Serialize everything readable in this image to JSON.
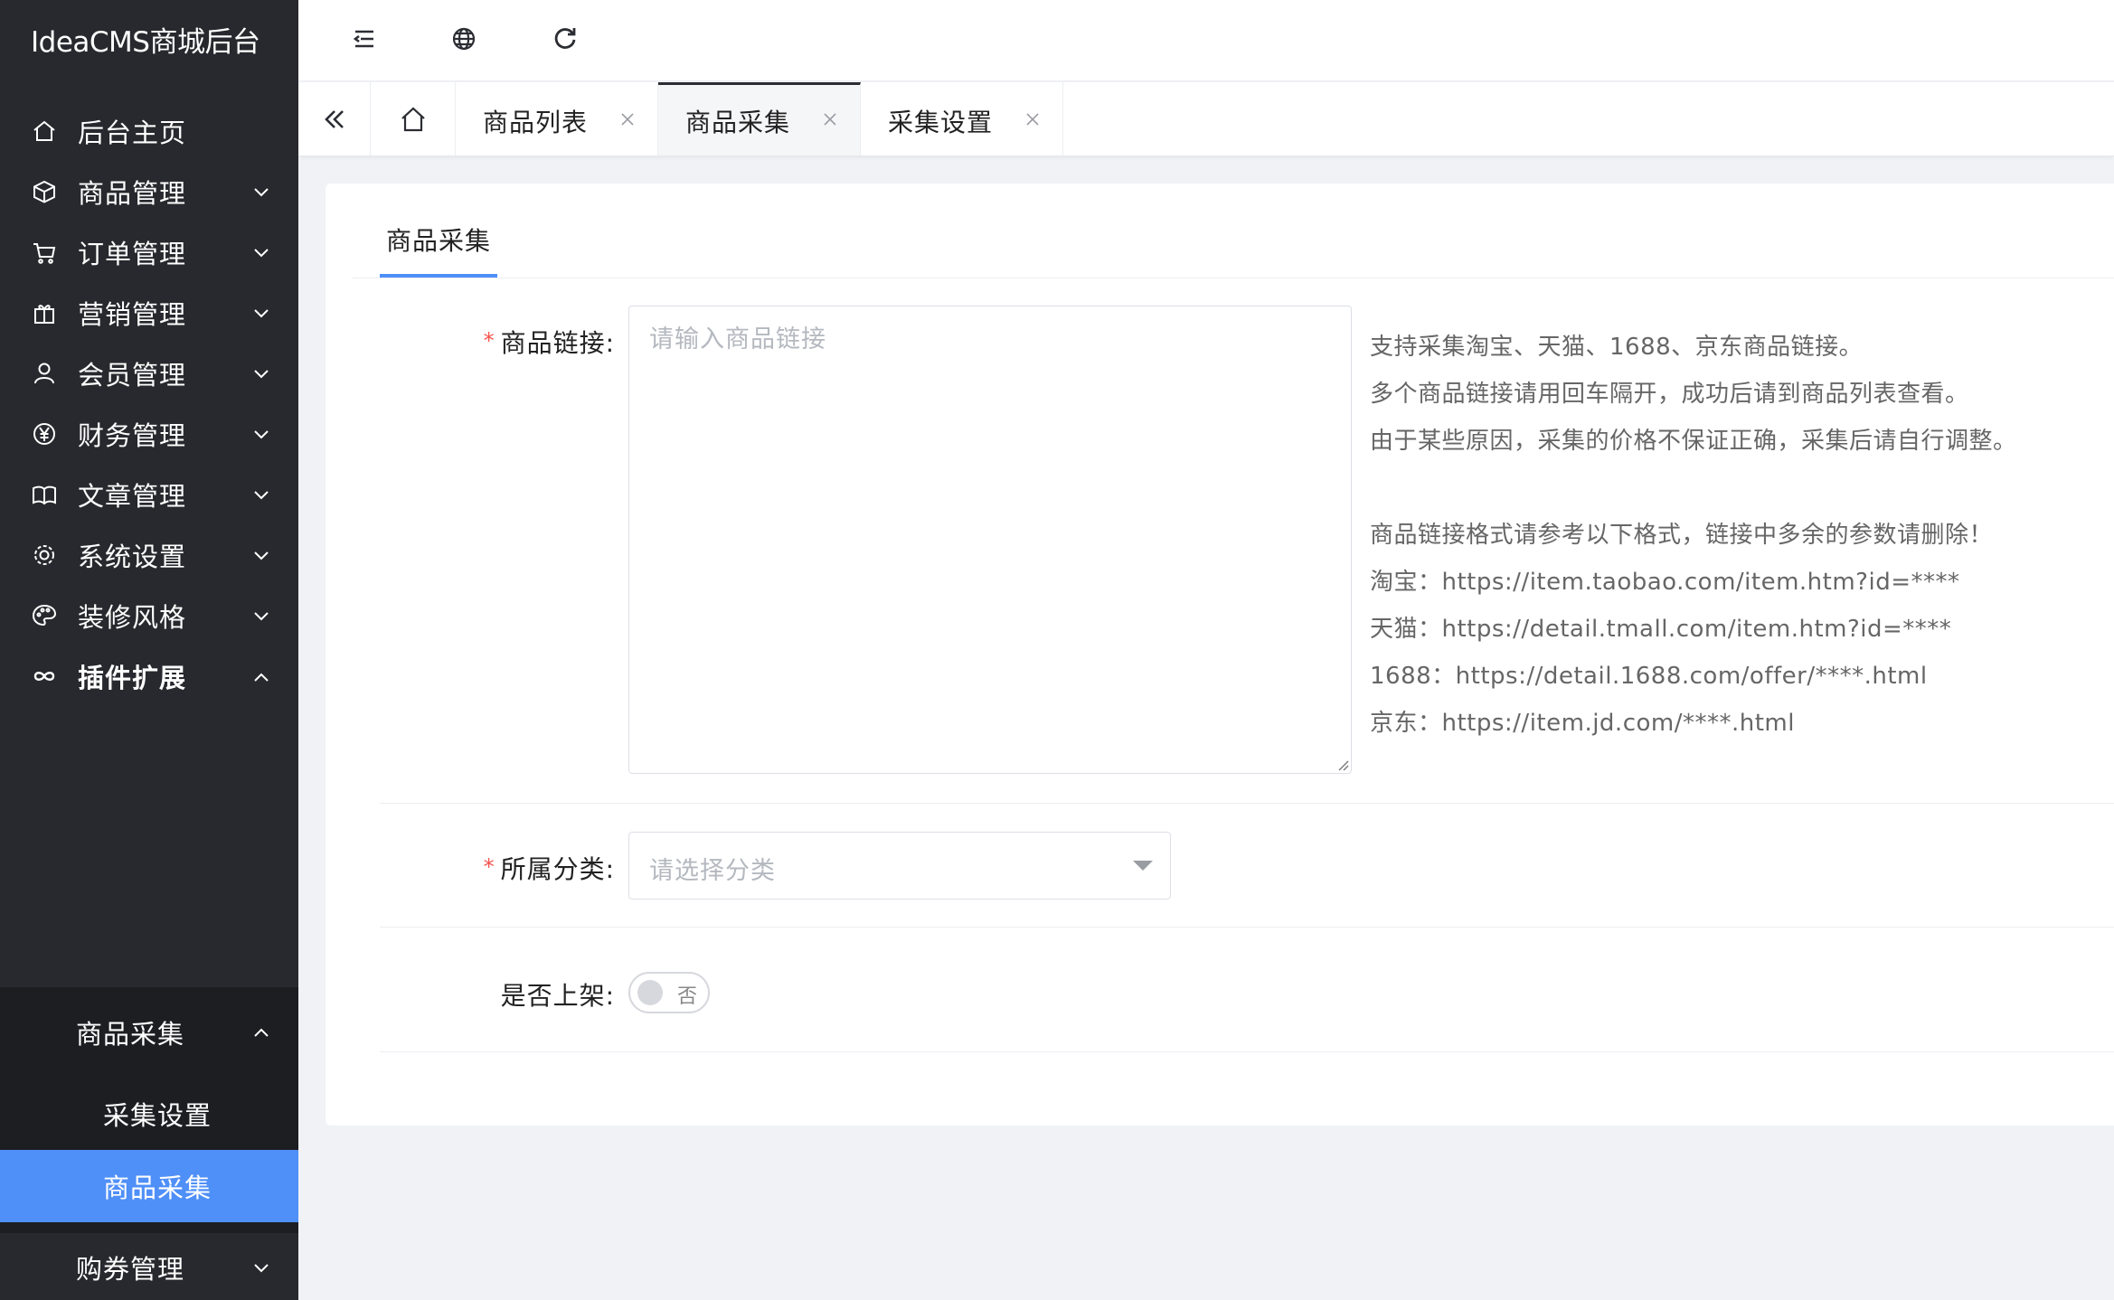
{
  "app": {
    "title": "IdeaCMS商城后台"
  },
  "sidebar": {
    "items": [
      {
        "label": "后台主页",
        "icon": "home-icon"
      },
      {
        "label": "商品管理",
        "icon": "box-icon"
      },
      {
        "label": "订单管理",
        "icon": "cart-icon"
      },
      {
        "label": "营销管理",
        "icon": "gift-icon"
      },
      {
        "label": "会员管理",
        "icon": "user-icon"
      },
      {
        "label": "财务管理",
        "icon": "yen-icon"
      },
      {
        "label": "文章管理",
        "icon": "book-icon"
      },
      {
        "label": "系统设置",
        "icon": "gear-icon"
      },
      {
        "label": "装修风格",
        "icon": "palette-icon"
      },
      {
        "label": "插件扩展",
        "icon": "infinity-icon",
        "expanded": true
      }
    ],
    "submenu": {
      "group_label": "商品采集",
      "children": [
        {
          "label": "采集设置"
        },
        {
          "label": "商品采集",
          "active": true
        }
      ]
    },
    "after_items": [
      {
        "label": "购券管理"
      }
    ]
  },
  "topbar": {
    "icons": [
      "menu-fold-icon",
      "globe-icon",
      "refresh-icon"
    ]
  },
  "tabs": [
    {
      "label": "商品列表",
      "active": false
    },
    {
      "label": "商品采集",
      "active": true
    },
    {
      "label": "采集设置",
      "active": false
    }
  ],
  "card": {
    "tab_label": "商品采集",
    "form": {
      "link": {
        "required_mark": "*",
        "label": "商品链接:",
        "placeholder": "请输入商品链接",
        "help": [
          "支持采集淘宝、天猫、1688、京东商品链接。",
          "多个商品链接请用回车隔开，成功后请到商品列表查看。",
          "由于某些原因，采集的价格不保证正确，采集后请自行调整。",
          "",
          "商品链接格式请参考以下格式，链接中多余的参数请删除！",
          "淘宝：https://item.taobao.com/item.htm?id=****",
          "天猫：https://detail.tmall.com/item.htm?id=****",
          "1688：https://detail.1688.com/offer/****.html",
          "京东：https://item.jd.com/****.html"
        ]
      },
      "category": {
        "required_mark": "*",
        "label": "所属分类:",
        "placeholder": "请选择分类"
      },
      "on_shelf": {
        "label": "是否上架:",
        "switch_text": "否",
        "value": false
      }
    }
  },
  "colors": {
    "sidebar_bg": "#28292e",
    "submenu_bg": "#1d1e22",
    "accent": "#4f8ff8",
    "required": "#f4524d"
  }
}
